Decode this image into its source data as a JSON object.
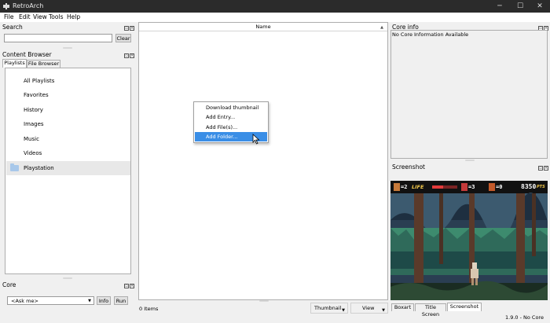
{
  "window": {
    "title": "RetroArch",
    "minimize": "─",
    "maximize": "☐",
    "close": "✕"
  },
  "menu": [
    "File",
    "Edit",
    "View",
    "Tools",
    "Help"
  ],
  "search": {
    "title": "Search",
    "value": "",
    "clear_label": "Clear"
  },
  "content_browser": {
    "title": "Content Browser",
    "tabs": [
      "Playlists",
      "File Browser"
    ],
    "playlists": [
      "All Playlists",
      "Favorites",
      "History",
      "Images",
      "Music",
      "Videos",
      "Playstation"
    ]
  },
  "core_panel": {
    "title": "Core",
    "selected": "<Ask me>",
    "info_label": "Info",
    "run_label": "Run"
  },
  "grid": {
    "column_name": "Name",
    "item_count": "0 Items",
    "view_mode": "Thumbnail",
    "view_label": "View"
  },
  "context_menu": {
    "items": [
      "Download thumbnail",
      "Add Entry...",
      "Add File(s)...",
      "Add Folder..."
    ],
    "highlighted_index": 3
  },
  "core_info": {
    "title": "Core info",
    "text": "No Core Information Available"
  },
  "screenshot": {
    "title": "Screenshot",
    "tabs": [
      "Boxart",
      "Title Screen",
      "Screenshot"
    ],
    "hud": {
      "lives": "=2",
      "life_label": "LIFE",
      "items1": "=3",
      "items2": "=0",
      "score": "8350",
      "pts": "PTS"
    }
  },
  "status": {
    "version": "1.9.0 - No Core"
  },
  "colors": {
    "accent": "#3a8ee6",
    "titlebar": "#2b2b2b"
  }
}
